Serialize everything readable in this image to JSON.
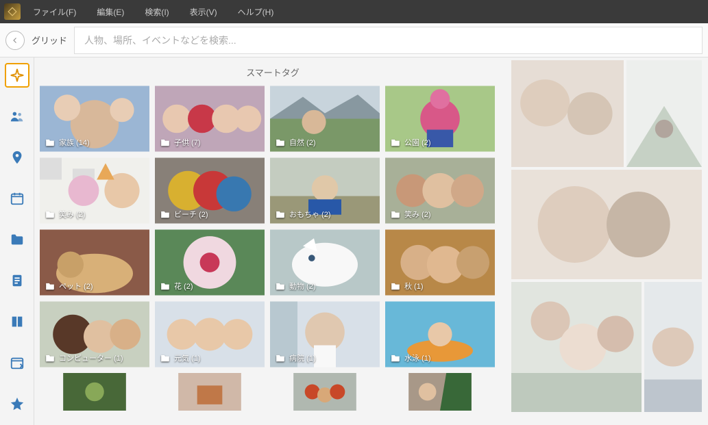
{
  "menubar": {
    "items": [
      "ファイル(F)",
      "編集(E)",
      "検索(I)",
      "表示(V)",
      "ヘルプ(H)"
    ]
  },
  "search": {
    "grid_label": "グリッド",
    "placeholder": "人物、場所、イベントなどを検索..."
  },
  "smart_tags": {
    "title": "スマートタグ",
    "tiles": [
      {
        "label": "家族 (14)",
        "palette": "family"
      },
      {
        "label": "子供 (7)",
        "palette": "kids"
      },
      {
        "label": "自然 (2)",
        "palette": "nature"
      },
      {
        "label": "公園 (2)",
        "palette": "park"
      },
      {
        "label": "笑み (2)",
        "palette": "smile"
      },
      {
        "label": "ビーチ (2)",
        "palette": "beach"
      },
      {
        "label": "おもちゃ (2)",
        "palette": "toy"
      },
      {
        "label": "笑み (2)",
        "palette": "smile2"
      },
      {
        "label": "ペット (2)",
        "palette": "pet"
      },
      {
        "label": "花 (2)",
        "palette": "flower"
      },
      {
        "label": "動物 (2)",
        "palette": "animal"
      },
      {
        "label": "秋 (1)",
        "palette": "autumn"
      },
      {
        "label": "コンピューター (1)",
        "palette": "computer"
      },
      {
        "label": "元気 (1)",
        "palette": "genki"
      },
      {
        "label": "病院 (1)",
        "palette": "hospital"
      },
      {
        "label": "水泳 (1)",
        "palette": "swim"
      }
    ],
    "tiles_partial": [
      {
        "palette": "p1"
      },
      {
        "palette": "p2"
      },
      {
        "palette": "p3"
      },
      {
        "palette": "p4"
      }
    ]
  },
  "nav": {
    "items": [
      "smart",
      "people",
      "places",
      "calendar",
      "folder",
      "document",
      "book",
      "import",
      "star"
    ]
  }
}
